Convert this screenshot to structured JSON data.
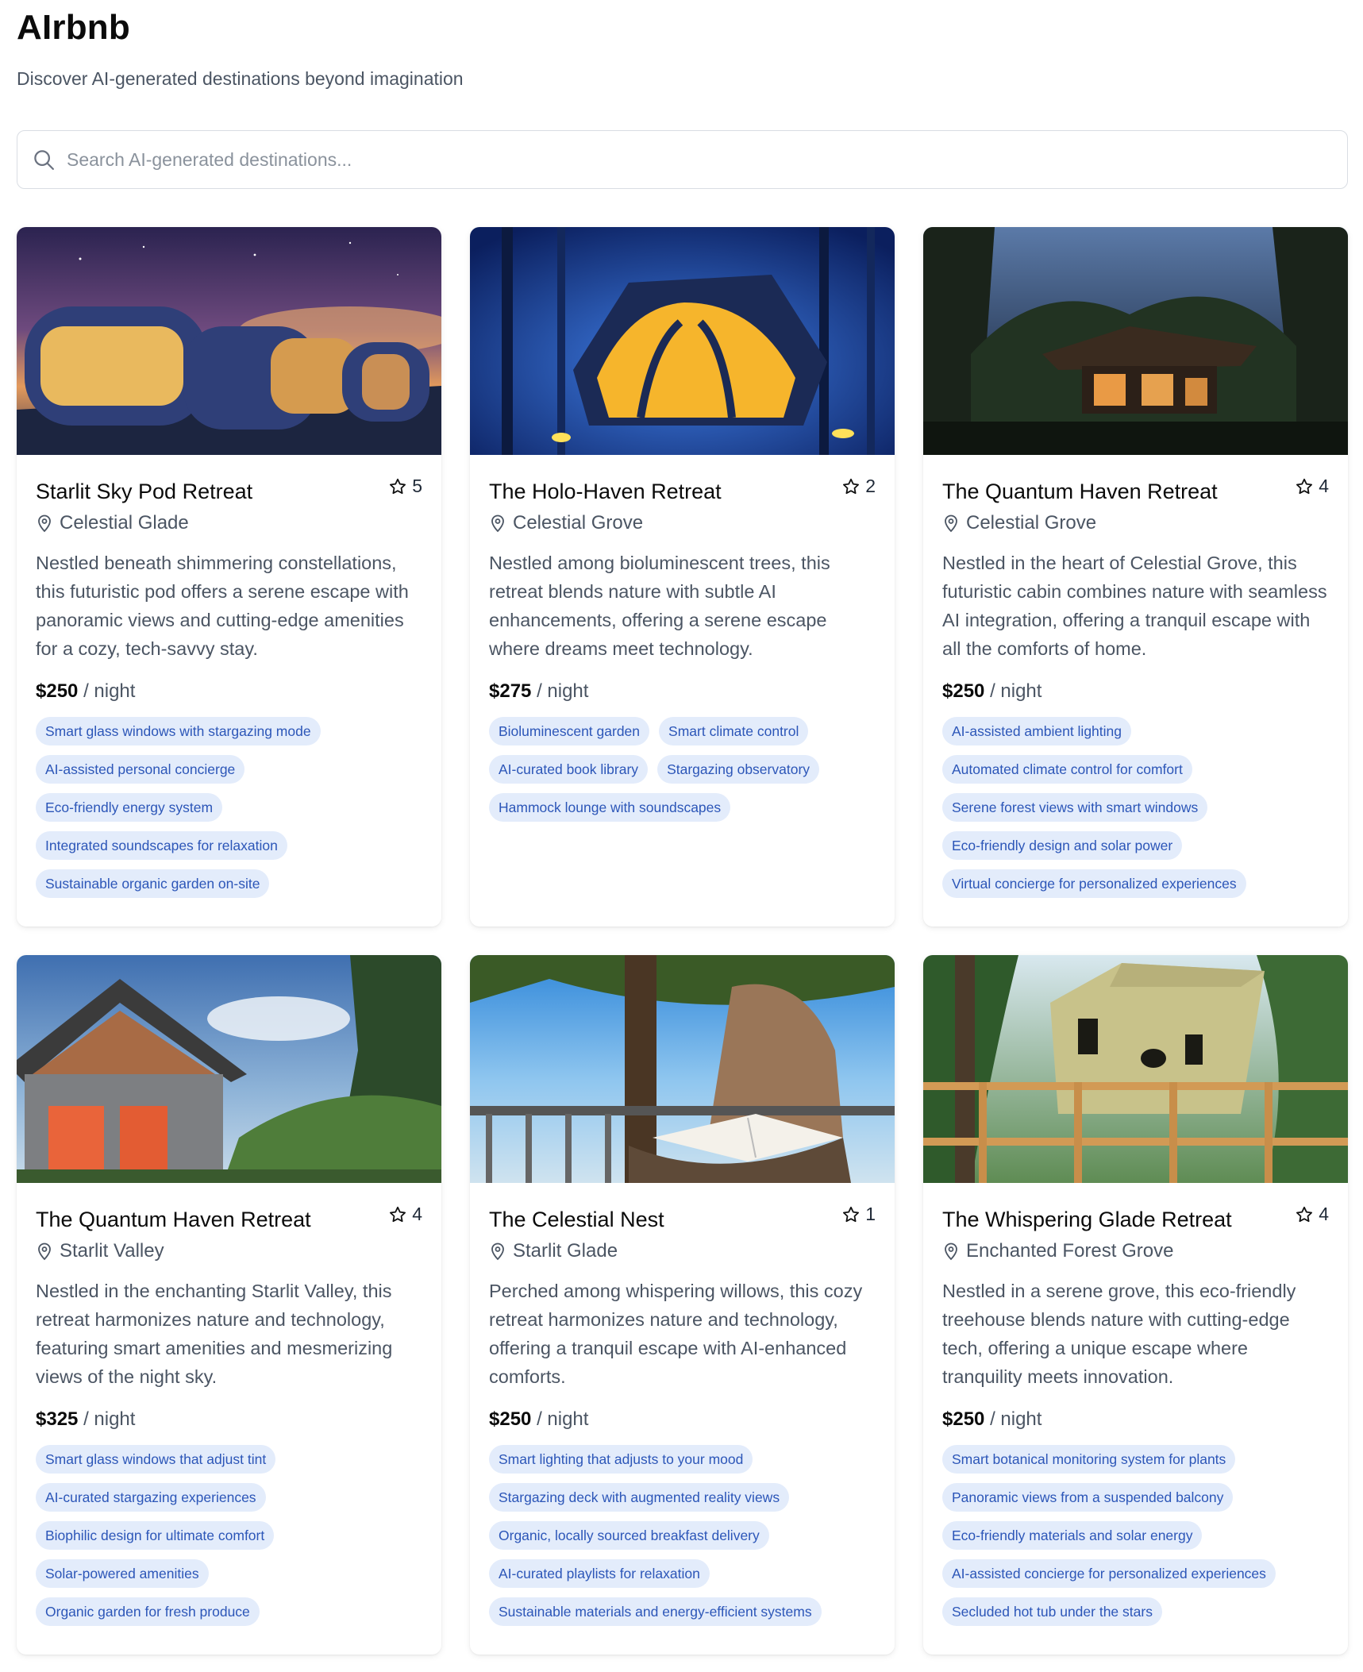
{
  "header": {
    "brand": "AIrbnb",
    "tagline": "Discover AI-generated destinations beyond imagination"
  },
  "search": {
    "placeholder": "Search AI-generated destinations...",
    "value": ""
  },
  "price_unit": "/ night",
  "listings": [
    {
      "title": "Starlit Sky Pod Retreat",
      "rating": "5",
      "location": "Celestial Glade",
      "description": "Nestled beneath shimmering constellations, this futuristic pod offers a serene escape with panoramic views and cutting-edge amenities for a cozy, tech-savvy stay.",
      "price": "$250",
      "features": [
        "Smart glass windows with stargazing mode",
        "AI-assisted personal concierge",
        "Eco-friendly energy system",
        "Integrated soundscapes for relaxation",
        "Sustainable organic garden on-site"
      ]
    },
    {
      "title": "The Holo-Haven Retreat",
      "rating": "2",
      "location": "Celestial Grove",
      "description": "Nestled among bioluminescent trees, this retreat blends nature with subtle AI enhancements, offering a serene escape where dreams meet technology.",
      "price": "$275",
      "features": [
        "Bioluminescent garden",
        "Smart climate control",
        "AI-curated book library",
        "Stargazing observatory",
        "Hammock lounge with soundscapes"
      ]
    },
    {
      "title": "The Quantum Haven Retreat",
      "rating": "4",
      "location": "Celestial Grove",
      "description": "Nestled in the heart of Celestial Grove, this futuristic cabin combines nature with seamless AI integration, offering a tranquil escape with all the comforts of home.",
      "price": "$250",
      "features": [
        "AI-assisted ambient lighting",
        "Automated climate control for comfort",
        "Serene forest views with smart windows",
        "Eco-friendly design and solar power",
        "Virtual concierge for personalized experiences"
      ]
    },
    {
      "title": "The Quantum Haven Retreat",
      "rating": "4",
      "location": "Starlit Valley",
      "description": "Nestled in the enchanting Starlit Valley, this retreat harmonizes nature and technology, featuring smart amenities and mesmerizing views of the night sky.",
      "price": "$325",
      "features": [
        "Smart glass windows that adjust tint",
        "AI-curated stargazing experiences",
        "Biophilic design for ultimate comfort",
        "Solar-powered amenities",
        "Organic garden for fresh produce"
      ]
    },
    {
      "title": "The Celestial Nest",
      "rating": "1",
      "location": "Starlit Glade",
      "description": "Perched among whispering willows, this cozy retreat harmonizes nature and technology, offering a tranquil escape with AI-enhanced comforts.",
      "price": "$250",
      "features": [
        "Smart lighting that adjusts to your mood",
        "Stargazing deck with augmented reality views",
        "Organic, locally sourced breakfast delivery",
        "AI-curated playlists for relaxation",
        "Sustainable materials and energy-efficient systems"
      ]
    },
    {
      "title": "The Whispering Glade Retreat",
      "rating": "4",
      "location": "Enchanted Forest Grove",
      "description": "Nestled in a serene grove, this eco-friendly treehouse blends nature with cutting-edge tech, offering a unique escape where tranquility meets innovation.",
      "price": "$250",
      "features": [
        "Smart botanical monitoring system for plants",
        "Panoramic views from a suspended balcony",
        "Eco-friendly materials and solar energy",
        "AI-assisted concierge for personalized experiences",
        "Secluded hot tub under the stars"
      ]
    }
  ]
}
